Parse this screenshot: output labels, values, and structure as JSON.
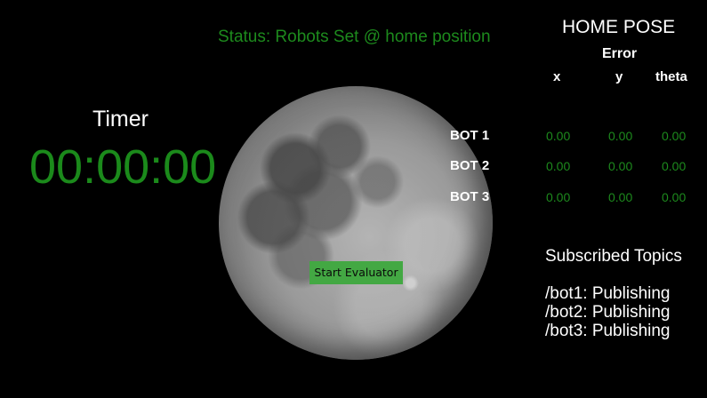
{
  "status": {
    "text": "Status: Robots Set @ home position",
    "color": "#1d8a1d"
  },
  "timer": {
    "label": "Timer",
    "value": "00:00:00",
    "color": "#1b8a1b"
  },
  "controls": {
    "start_label": "Start Evaluator",
    "button_color": "#43a843"
  },
  "home_pose": {
    "title": "HOME POSE",
    "error_label": "Error",
    "columns": [
      "x",
      "y",
      "theta"
    ],
    "rows": [
      {
        "bot": "BOT 1",
        "values": [
          "0.00",
          "0.00",
          "0.00"
        ]
      },
      {
        "bot": "BOT 2",
        "values": [
          "0.00",
          "0.00",
          "0.00"
        ]
      },
      {
        "bot": "BOT 3",
        "values": [
          "0.00",
          "0.00",
          "0.00"
        ]
      }
    ]
  },
  "topics": {
    "title": "Subscribed Topics",
    "items": [
      "/bot1: Publishing",
      "/bot2: Publishing",
      "/bot3: Publishing"
    ]
  },
  "background": {
    "image": "moon",
    "color": "#000000"
  }
}
